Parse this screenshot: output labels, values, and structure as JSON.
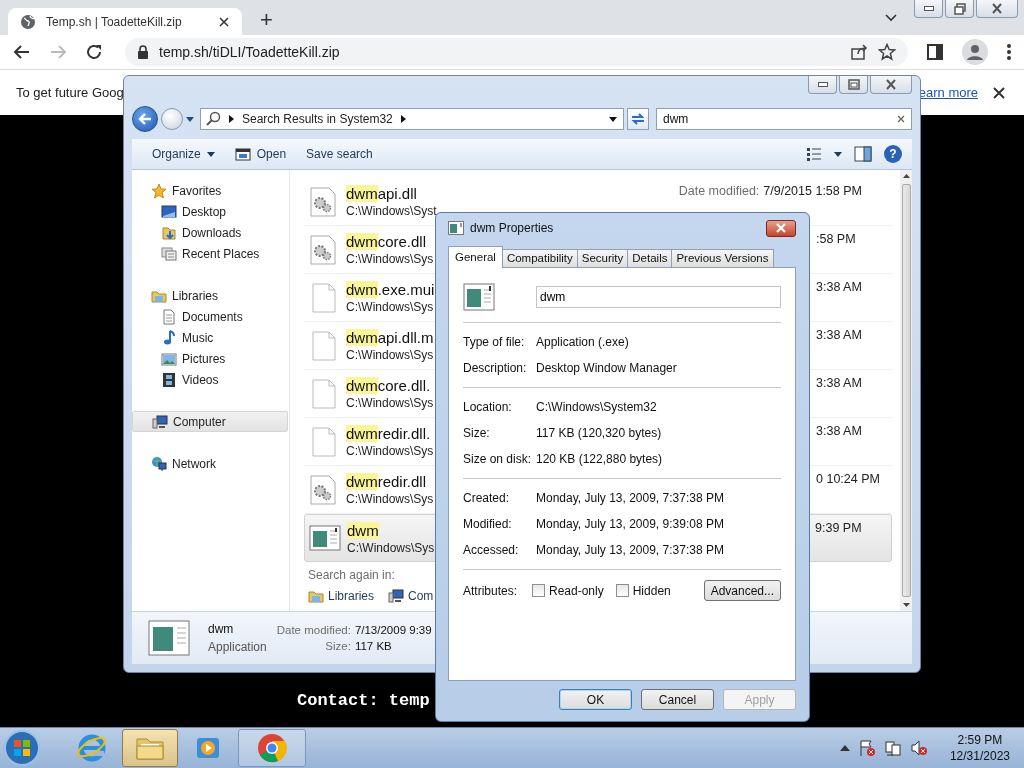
{
  "browser": {
    "tab": {
      "title": "Temp.sh | ToadetteKill.zip",
      "selected": true
    },
    "new_tab": "+",
    "address": "temp.sh/tiDLI/ToadetteKill.zip",
    "forward_disabled": true,
    "infobar": {
      "text": "To get future Goog",
      "link": "earn more"
    },
    "page_text": "Contact: temp"
  },
  "explorer": {
    "breadcrumb": "Search Results in System32",
    "help": "?",
    "search": {
      "value": "dwm"
    },
    "commands": [
      {
        "kind": "organize",
        "label": "Organize"
      },
      {
        "kind": "open",
        "label": "Open"
      },
      {
        "kind": "plain",
        "label": "Save search"
      }
    ],
    "nav": [
      {
        "kind": "star",
        "label": "Favorites",
        "selected": false,
        "children": [
          {
            "kind": "desktop",
            "label": "Desktop",
            "selected": false
          },
          {
            "kind": "downloads",
            "label": "Downloads",
            "selected": false
          },
          {
            "kind": "recent",
            "label": "Recent Places",
            "selected": false
          }
        ]
      },
      {
        "kind": "library",
        "label": "Libraries",
        "selected": false,
        "children": [
          {
            "kind": "document",
            "label": "Documents",
            "selected": false
          },
          {
            "kind": "music",
            "label": "Music",
            "selected": false
          },
          {
            "kind": "picture",
            "label": "Pictures",
            "selected": false
          },
          {
            "kind": "video",
            "label": "Videos",
            "selected": false
          }
        ]
      },
      {
        "kind": "computer",
        "label": "Computer",
        "selected": true
      },
      {
        "kind": "network",
        "label": "Network",
        "selected": false
      }
    ],
    "files": [
      {
        "kind": "dll",
        "match": "dwm",
        "rest": "api.dll",
        "path": "C:\\Windows\\Syst",
        "modified_label": "Date modified:",
        "modified": "7/9/2015 1:58 PM",
        "selected": false
      },
      {
        "kind": "dll",
        "match": "dwm",
        "rest": "core.dll",
        "path": "C:\\Windows\\Sys",
        "modified": ":58 PM",
        "selected": false
      },
      {
        "kind": "blank",
        "match": "dwm",
        "rest": ".exe.mui",
        "path": "C:\\Windows\\Sys",
        "modified": "3:38 AM",
        "selected": false
      },
      {
        "kind": "blank",
        "match": "dwm",
        "rest": "api.dll.m",
        "path": "C:\\Windows\\Sys",
        "modified": "3:38 AM",
        "selected": false
      },
      {
        "kind": "blank",
        "match": "dwm",
        "rest": "core.dll.",
        "path": "C:\\Windows\\Sys",
        "modified": "3:38 AM",
        "selected": false
      },
      {
        "kind": "blank",
        "match": "dwm",
        "rest": "redir.dll.",
        "path": "C:\\Windows\\Sys",
        "modified": "3:38 AM",
        "selected": false
      },
      {
        "kind": "dll",
        "match": "dwm",
        "rest": "redir.dll",
        "path": "C:\\Windows\\Sys",
        "modified": "0 10:24 PM",
        "selected": false
      },
      {
        "kind": "exe",
        "match": "dwm",
        "path": "C:\\Windows\\Sys",
        "modified": "9:39 PM",
        "selected": true
      }
    ],
    "search_again": {
      "label": "Search again in:",
      "places": [
        {
          "kind": "library",
          "label": "Libraries"
        },
        {
          "kind": "computer",
          "label": "Com"
        }
      ]
    },
    "details": {
      "name": "dwm",
      "type": "Application",
      "fields": [
        {
          "label": "Date modified:",
          "value": "7/13/2009 9:39"
        },
        {
          "label": "Size:",
          "value": "117 KB"
        }
      ]
    }
  },
  "dialog": {
    "title": "dwm Properties",
    "tabs": [
      {
        "label": "General",
        "selected": true
      },
      {
        "label": "Compatibility",
        "selected": false
      },
      {
        "label": "Security",
        "selected": false
      },
      {
        "label": "Details",
        "selected": false
      },
      {
        "label": "Previous Versions",
        "selected": false
      }
    ],
    "name": "dwm",
    "sections": [
      [
        {
          "label": "Type of file:",
          "value": "Application (.exe)"
        },
        {
          "label": "Description:",
          "value": "Desktop Window Manager"
        }
      ],
      [
        {
          "label": "Location:",
          "value": "C:\\Windows\\System32"
        },
        {
          "label": "Size:",
          "value": "117 KB (120,320 bytes)"
        },
        {
          "label": "Size on disk:",
          "value": "120 KB (122,880 bytes)"
        }
      ],
      [
        {
          "label": "Created:",
          "value": "Monday, July 13, 2009, 7:37:38 PM"
        },
        {
          "label": "Modified:",
          "value": "Monday, July 13, 2009, 9:39:08 PM"
        },
        {
          "label": "Accessed:",
          "value": "Monday, July 13, 2009, 7:37:38 PM"
        }
      ]
    ],
    "attributes": {
      "label": "Attributes:",
      "checkboxes": [
        {
          "label": "Read-only",
          "checked": false
        },
        {
          "label": "Hidden",
          "checked": false
        }
      ],
      "button": "Advanced..."
    },
    "buttons": [
      {
        "label": "OK",
        "default": true,
        "disabled": false
      },
      {
        "label": "Cancel",
        "default": false,
        "disabled": false
      },
      {
        "label": "Apply",
        "default": false,
        "disabled": true
      }
    ]
  },
  "taskbar": {
    "apps": [
      {
        "kind": "ie",
        "selected": false,
        "running": false
      },
      {
        "kind": "explorer",
        "selected": true
      },
      {
        "kind": "media",
        "selected": false,
        "running": false
      },
      {
        "kind": "chrome",
        "selected": false,
        "running": true
      }
    ],
    "clock": {
      "time": "2:59 PM",
      "date": "12/31/2023"
    }
  }
}
